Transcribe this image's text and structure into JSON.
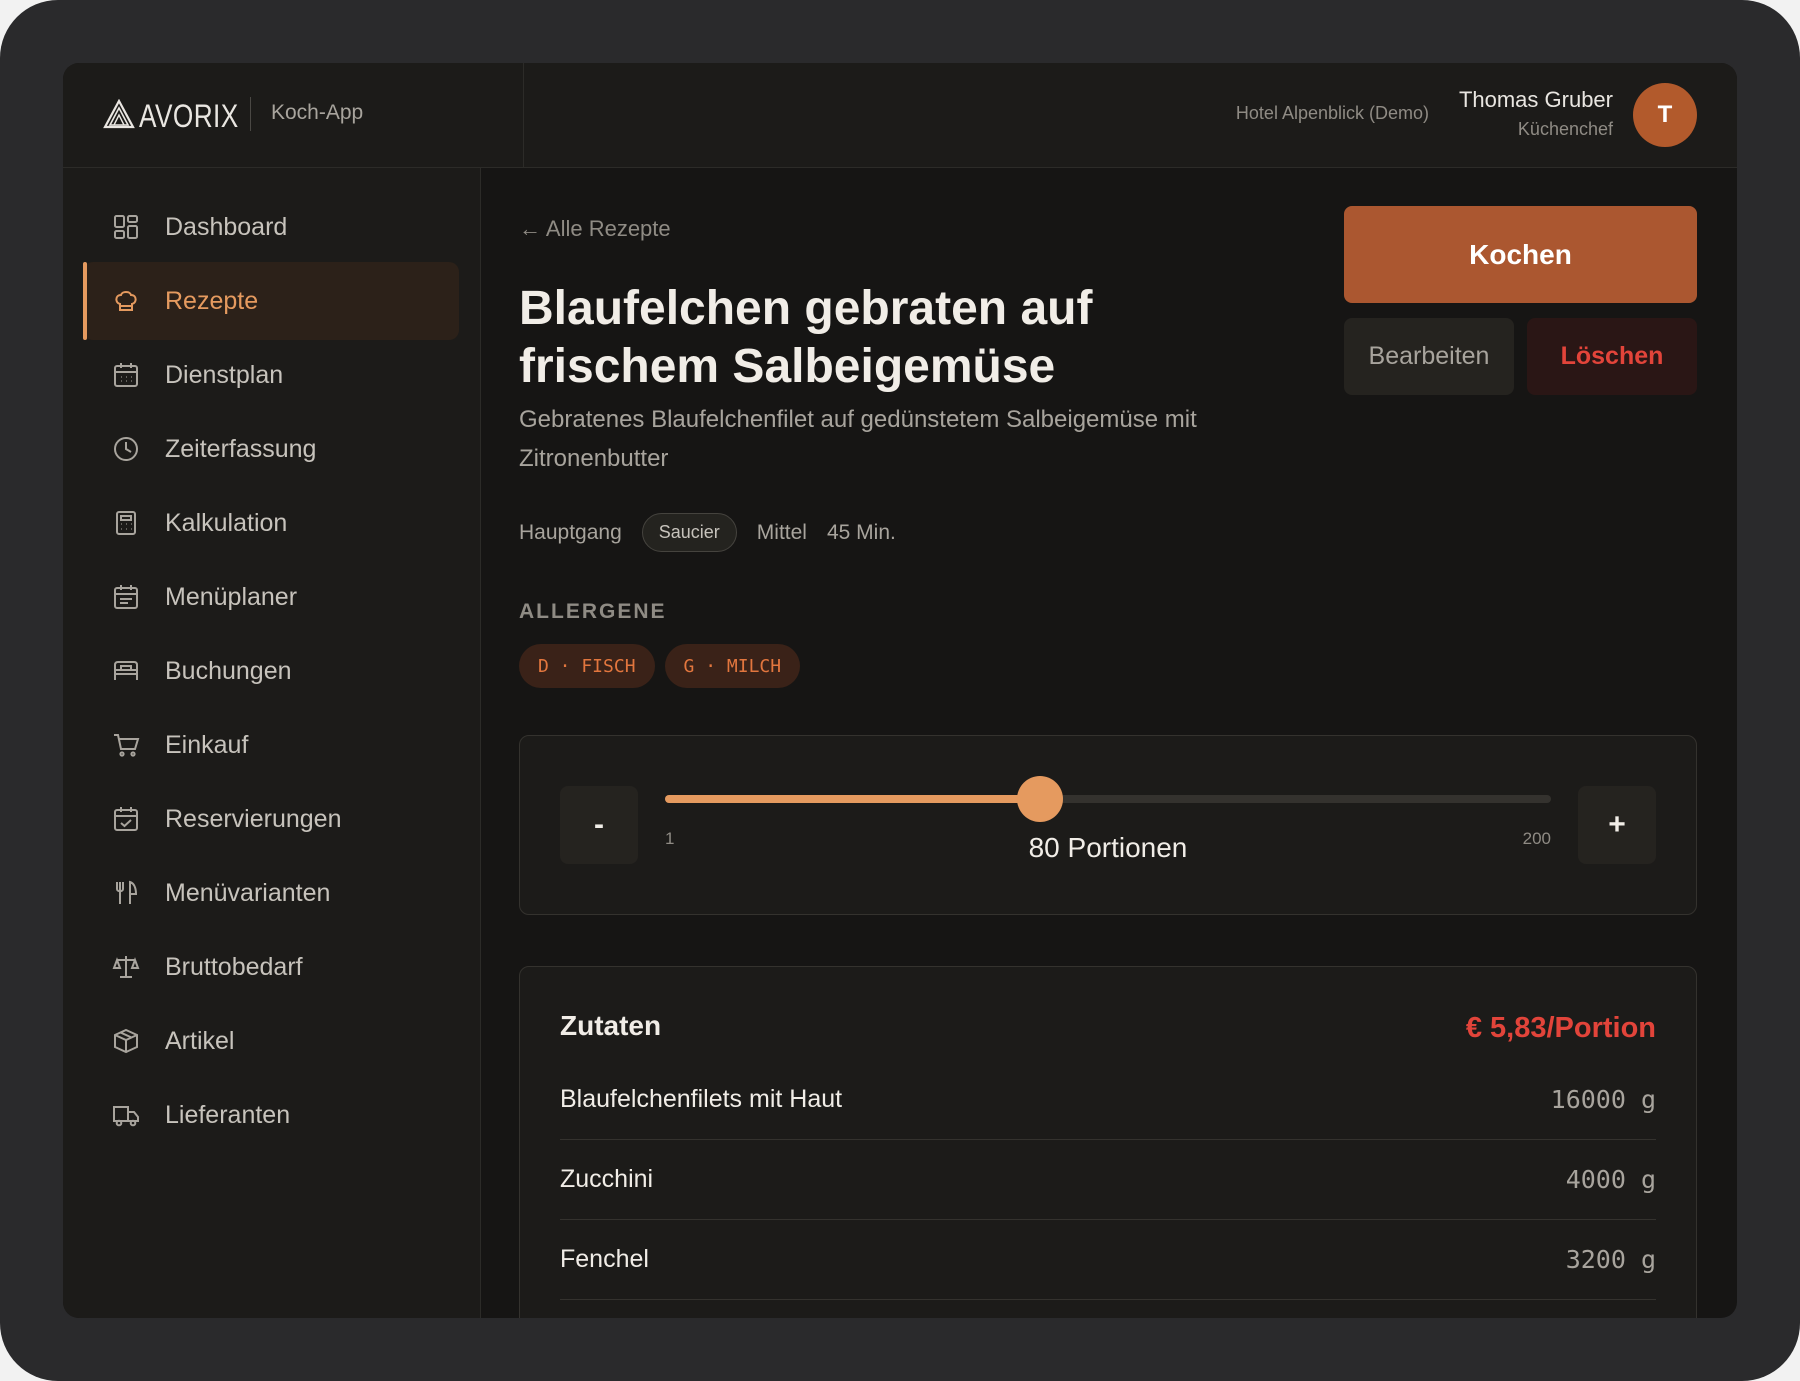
{
  "app": {
    "brand": "AVORIX",
    "app_name": "Koch-App"
  },
  "header": {
    "hotel": "Hotel Alpenblick (Demo)",
    "user_name": "Thomas Gruber",
    "user_role": "Küchenchef",
    "avatar_initial": "T"
  },
  "sidebar": {
    "items": [
      {
        "label": "Dashboard",
        "icon": "dashboard-icon"
      },
      {
        "label": "Rezepte",
        "icon": "chef-hat-icon",
        "active": true
      },
      {
        "label": "Dienstplan",
        "icon": "calendar-icon"
      },
      {
        "label": "Zeiterfassung",
        "icon": "clock-icon"
      },
      {
        "label": "Kalkulation",
        "icon": "calculator-icon"
      },
      {
        "label": "Menüplaner",
        "icon": "calendar-list-icon"
      },
      {
        "label": "Buchungen",
        "icon": "bed-icon"
      },
      {
        "label": "Einkauf",
        "icon": "cart-icon"
      },
      {
        "label": "Reservierungen",
        "icon": "calendar-check-icon"
      },
      {
        "label": "Menüvarianten",
        "icon": "cutlery-icon"
      },
      {
        "label": "Bruttobedarf",
        "icon": "scale-icon"
      },
      {
        "label": "Artikel",
        "icon": "box-icon"
      },
      {
        "label": "Lieferanten",
        "icon": "truck-icon"
      }
    ]
  },
  "recipe": {
    "back_link": "← Alle Rezepte",
    "title": "Blaufelchen gebraten auf frischem Salbeigemüse",
    "description": "Gebratenes Blaufelchenfilet auf gedünstetem Salbeigemüse mit Zitronenbutter",
    "course": "Hauptgang",
    "station": "Saucier",
    "difficulty": "Mittel",
    "duration": "45 Min.",
    "allergens_heading": "ALLERGENE",
    "allergens": [
      "D · FISCH",
      "G · MILCH"
    ]
  },
  "actions": {
    "cook": "Kochen",
    "edit": "Bearbeiten",
    "delete": "Löschen"
  },
  "portions": {
    "minus": "-",
    "plus": "+",
    "min": 1,
    "max": 200,
    "value": 80,
    "min_label": "1",
    "max_label": "200",
    "label": "80 Portionen"
  },
  "ingredients": {
    "title": "Zutaten",
    "cost_per_portion": "€ 5,83/Portion",
    "rows": [
      {
        "name": "Blaufelchenfilets mit Haut",
        "qty": "16000 g"
      },
      {
        "name": "Zucchini",
        "qty": "4000 g"
      },
      {
        "name": "Fenchel",
        "qty": "3200 g"
      }
    ]
  },
  "colors": {
    "accent": "#e59a5f",
    "cook_button": "#ab5730",
    "danger": "#e2443a",
    "avatar": "#b25a2c"
  }
}
